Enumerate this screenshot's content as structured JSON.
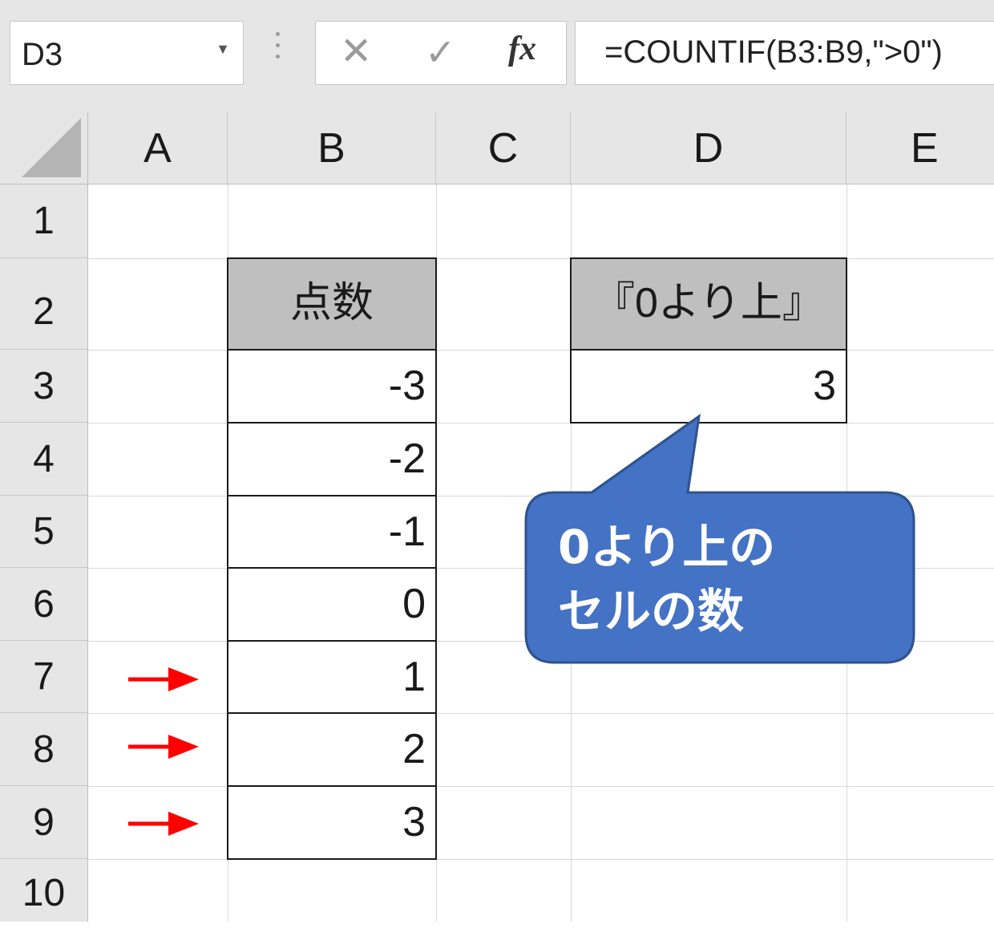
{
  "formula_bar": {
    "name_box": "D3",
    "cancel_icon": "close-icon",
    "enter_icon": "check-icon",
    "function_label": "fx",
    "formula": "=COUNTIF(B3:B9,\">0\")"
  },
  "columns": [
    "A",
    "B",
    "C",
    "D",
    "E"
  ],
  "rows": [
    "1",
    "2",
    "3",
    "4",
    "5",
    "6",
    "7",
    "8",
    "9",
    "10"
  ],
  "table_b": {
    "header": "点数",
    "values": [
      "-3",
      "-2",
      "-1",
      "0",
      "1",
      "2",
      "3"
    ]
  },
  "table_d": {
    "header": "『0より上』",
    "value": "3"
  },
  "callout": {
    "line1": "0より上の",
    "line2": "セルの数",
    "fill_color": "#4472c4"
  },
  "arrows": {
    "color": "#ff0000",
    "rows": [
      "7",
      "8",
      "9"
    ]
  }
}
